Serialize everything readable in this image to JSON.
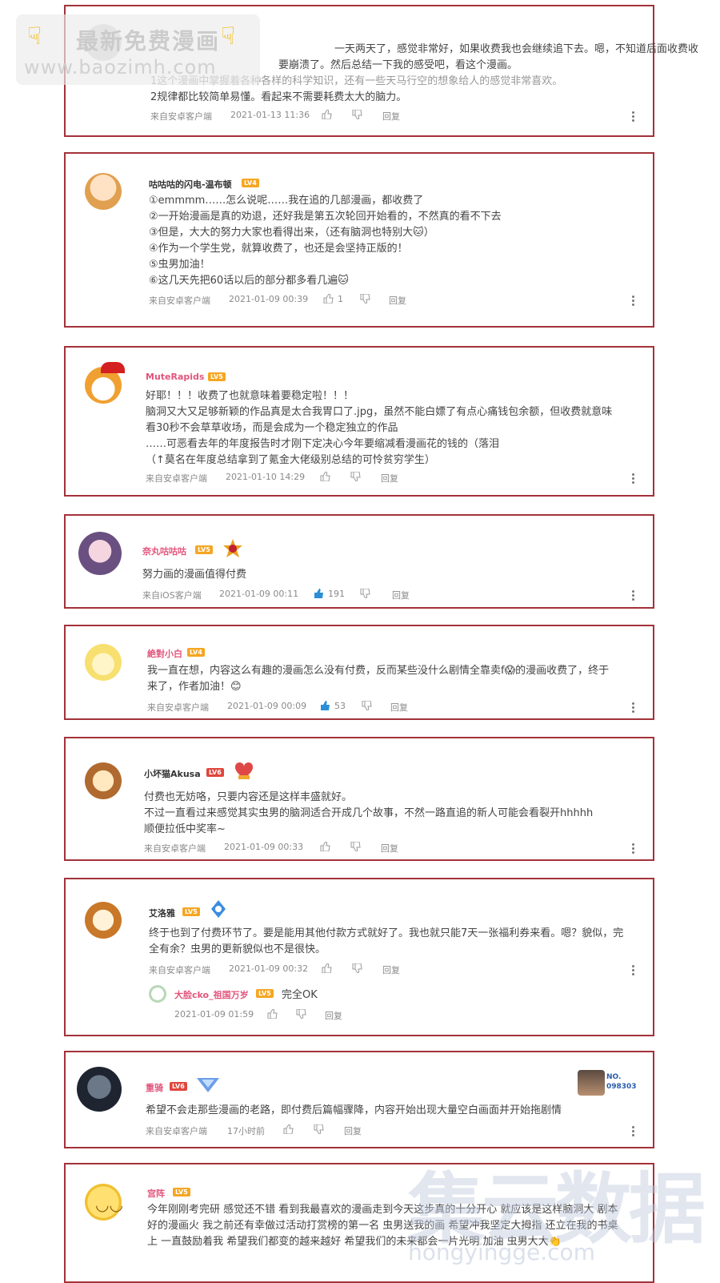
{
  "watermark": {
    "line1": "最新免费漫画",
    "line2": "www.baozimh.com",
    "hand_icon": "pointing-hand-icon"
  },
  "labels": {
    "reply": "回复"
  },
  "comments": [
    {
      "username": "",
      "level": "",
      "lines": [
        "一天两天了，感觉非常好，如果收费我也会继续追下去。嗯，不知道后面收费收",
        "要崩溃了。然后总结一下我的感受吧，看这个漫画。",
        "1这个漫画中掌握着各种各样的科学知识，还有一些天马行空的想象给人的感觉非常喜欢。",
        "2规律都比较简单易懂。看起来不需要耗费太大的脑力。"
      ],
      "source": "来自安卓客户端",
      "time": "2021-01-13 11:36",
      "likes": ""
    },
    {
      "username": "咕咕咕的闪电-温布顿",
      "level": "LV4",
      "lines": [
        "①emmmm……怎么说呢……我在追的几部漫画，都收费了",
        "②一开始漫画是真的劝退，还好我是第五次轮回开始看的，不然真的看不下去",
        "③但是，大大的努力大家也看得出来，（还有脑洞也特别大🐱）",
        "④作为一个学生党，就算收费了，也还是会坚持正版的！",
        "⑤虫男加油！",
        "⑥这几天先把60话以后的部分都多看几遍🐱"
      ],
      "source": "来自安卓客户端",
      "time": "2021-01-09 00:39",
      "likes": "1"
    },
    {
      "username": "MuteRapids",
      "level": "LV5",
      "lines": [
        "好耶！！！收费了也就意味着要稳定啦！！！",
        "脑洞又大又足够新颖的作品真是太合我胃口了.jpg，虽然不能白嫖了有点心痛钱包余额，但收费就意味",
        "看30秒不会草草收场，而是会成为一个稳定独立的作品",
        "……可恶看去年的年度报告时才刚下定决心今年要缩减看漫画花的钱的（落泪",
        "（↑莫名在年度总结拿到了氪金大佬级别总结的可怜贫穷学生）"
      ],
      "source": "来自安卓客户端",
      "time": "2021-01-10 14:29",
      "likes": ""
    },
    {
      "username": "奈丸咕咕咕",
      "level": "LV5",
      "lines": [
        "努力画的漫画值得付费"
      ],
      "source": "来自iOS客户端",
      "time": "2021-01-09 00:11",
      "likes": "191"
    },
    {
      "username": "絶對小白",
      "level": "LV4",
      "lines": [
        "我一直在想，内容这么有趣的漫画怎么没有付费，反而某些没什么剧情全靠卖f😱的漫画收费了，终于",
        "来了，作者加油！😊"
      ],
      "source": "来自安卓客户端",
      "time": "2021-01-09 00:09",
      "likes": "53"
    },
    {
      "username": "小坏猫Akusa",
      "level": "LV6",
      "lines": [
        "付费也无妨咯，只要内容还是这样丰盛就好。",
        "不过一直看过来感觉其实虫男的脑洞适合开成几个故事，不然一路直追的新人可能会看裂开hhhhh",
        "顺便拉低中奖率~"
      ],
      "source": "来自安卓客户端",
      "time": "2021-01-09 00:33",
      "likes": ""
    },
    {
      "username": "艾洛雅",
      "level": "LV5",
      "lines": [
        "终于也到了付费环节了。要是能用其他付款方式就好了。我也就只能7天一张福利券来看。嗯？貌似，完",
        "全有余？虫男的更新貌似也不是很快。"
      ],
      "source": "来自安卓客户端",
      "time": "2021-01-09 00:32",
      "likes": "",
      "reply": {
        "username": "大脸cko_祖国万岁",
        "level": "LV5",
        "text": "完全OK",
        "time": "2021-01-09 01:59"
      }
    },
    {
      "username": "重骑",
      "level": "LV6",
      "badge_no": "NO.",
      "badge_num": "098303",
      "lines": [
        "希望不会走那些漫画的老路，即付费后篇幅骤降，内容开始出现大量空白画面并开始拖剧情"
      ],
      "source": "来自安卓客户端",
      "time": "17小时前",
      "likes": ""
    },
    {
      "username": "宫阵",
      "level": "LV5",
      "lines": [
        "今年刚刚考完研 感觉还不错 看到我最喜欢的漫画走到今天这步真的十分开心 就应该是这样脑洞大 剧本",
        "好的漫画火 我之前还有幸做过活动打赏榜的第一名 虫男送我的画 希望冲我坚定大拇指 还立在我的书桌",
        "上 一直鼓励着我 希望我们都变的越来越好 希望我们的未来都会一片光明 加油 虫男大大👏"
      ]
    }
  ],
  "corner_watermark": {
    "line1": "集云数据",
    "line2": "hongyingge.com"
  }
}
